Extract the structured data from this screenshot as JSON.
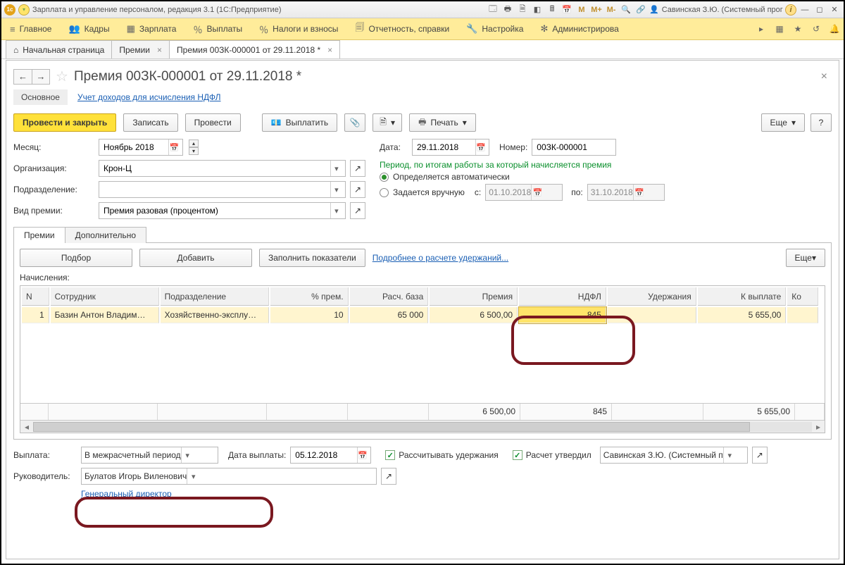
{
  "titlebar": {
    "app_title": "Зарплата и управление персоналом, редакция 3.1  (1С:Предприятие)",
    "m_labels": [
      "M",
      "M+",
      "M-"
    ],
    "user": "Савинская З.Ю. (Системный прог…"
  },
  "menu": {
    "items": [
      {
        "icon": "≡",
        "label": "Главное"
      },
      {
        "icon": "👥",
        "label": "Кадры"
      },
      {
        "icon": "▦",
        "label": "Зарплата"
      },
      {
        "icon": "%",
        "label": "Выплаты"
      },
      {
        "icon": "％",
        "label": "Налоги и взносы"
      },
      {
        "icon": "🗐",
        "label": "Отчетность, справки"
      },
      {
        "icon": "🔧",
        "label": "Настройка"
      },
      {
        "icon": "✻",
        "label": "Администрирова"
      }
    ]
  },
  "tabs": {
    "items": [
      {
        "icon": "⌂",
        "label": "Начальная страница",
        "closable": false
      },
      {
        "icon": "",
        "label": "Премии",
        "closable": true
      },
      {
        "icon": "",
        "label": "Премия 00ЗК-000001 от 29.11.2018 *",
        "closable": true,
        "active": true
      }
    ]
  },
  "doc": {
    "title": "Премия 00ЗК-000001 от 29.11.2018 *",
    "mode_main": "Основное",
    "mode_link": "Учет доходов для исчисления НДФЛ",
    "toolbar": {
      "post_close": "Провести и закрыть",
      "save": "Записать",
      "post": "Провести",
      "pay": "Выплатить",
      "print": "Печать",
      "more": "Еще",
      "help": "?"
    },
    "fields": {
      "month_lbl": "Месяц:",
      "month_val": "Ноябрь 2018",
      "org_lbl": "Организация:",
      "org_val": "Крон-Ц",
      "dept_lbl": "Подразделение:",
      "dept_val": "",
      "bonus_type_lbl": "Вид премии:",
      "bonus_type_val": "Премия разовая (процентом)",
      "date_lbl": "Дата:",
      "date_val": "29.11.2018",
      "num_lbl": "Номер:",
      "num_val": "00ЗК-000001",
      "period_head": "Период, по итогам работы за который начисляется премия",
      "period_auto": "Определяется автоматически",
      "period_manual": "Задается вручную",
      "period_from_lbl": "с:",
      "period_from": "01.10.2018",
      "period_to_lbl": "по:",
      "period_to": "31.10.2018"
    },
    "subtabs": {
      "bonus": "Премии",
      "extra": "Дополнительно"
    },
    "subbar": {
      "pick": "Подбор",
      "add": "Добавить",
      "fill": "Заполнить показатели",
      "detail_link": "Подробнее о расчете удержаний...",
      "more": "Еще"
    },
    "table": {
      "section": "Начисления:",
      "cols": [
        "N",
        "Сотрудник",
        "Подразделение",
        "% прем.",
        "Расч. база",
        "Премия",
        "НДФЛ",
        "Удержания",
        "К выплате",
        "Ко"
      ],
      "row": {
        "n": "1",
        "emp": "Базин Антон Владим…",
        "dep": "Хозяйственно-эксплу…",
        "pct": "10",
        "base": "65 000",
        "prem": "6 500,00",
        "ndfl": "845",
        "hold": "",
        "pay": "5 655,00"
      },
      "totals": {
        "prem": "6 500,00",
        "ndfl": "845",
        "pay": "5 655,00"
      }
    },
    "bottom": {
      "pay_lbl": "Выплата:",
      "pay_mode": "В межрасчетный период",
      "pay_date_lbl": "Дата выплаты:",
      "pay_date": "05.12.2018",
      "calc_hold": "Рассчитывать удержания",
      "approved": "Расчет утвердил",
      "approver": "Савинская З.Ю. (Системный п",
      "manager_lbl": "Руководитель:",
      "manager": "Булатов Игорь Виленович",
      "manager_pos": "Генеральный директор"
    }
  }
}
